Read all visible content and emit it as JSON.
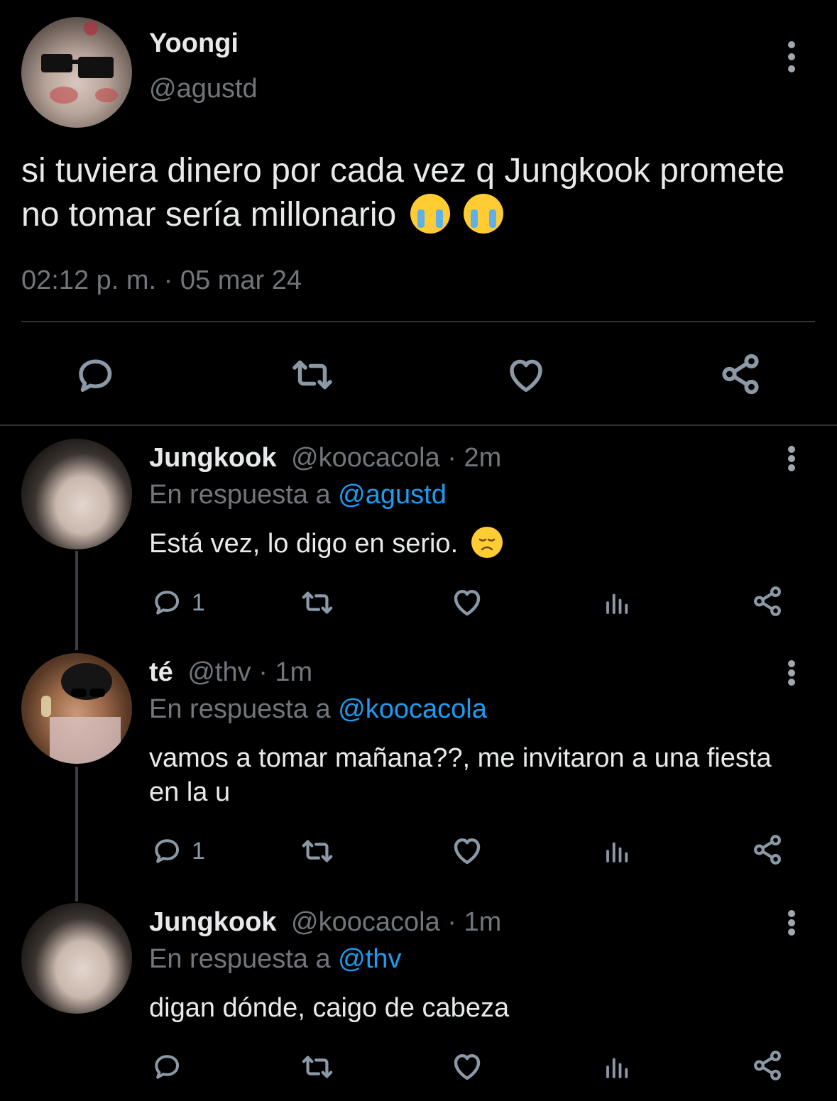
{
  "main_tweet": {
    "display_name": "Yoongi",
    "handle": "@agustd",
    "text": "si tuviera dinero por cada vez q Jungkook promete no tomar sería millonario",
    "emoji": "😭😭",
    "timestamp": "02:12 p. m. · 05 mar 24",
    "actions": [
      "reply-icon",
      "retweet-icon",
      "like-icon",
      "share-icon"
    ]
  },
  "replies": [
    {
      "display_name": "Jungkook",
      "handle": "@koocacola",
      "time": "· 2m",
      "reply_prefix": "En respuesta a",
      "reply_to": "@agustd",
      "text": "Está vez, lo digo en serio.",
      "emoji": "😞",
      "reply_count": "1"
    },
    {
      "display_name": "té",
      "handle": "@thv",
      "time": "· 1m",
      "reply_prefix": "En respuesta a",
      "reply_to": "@koocacola",
      "text": "vamos a tomar mañana??, me invitaron a una fiesta en la u",
      "reply_count": "1"
    },
    {
      "display_name": "Jungkook",
      "handle": "@koocacola",
      "time": "· 1m",
      "reply_prefix": "En respuesta a",
      "reply_to": "@thv",
      "text": "digan dónde, caigo de cabeza",
      "reply_count": ""
    }
  ],
  "colors": {
    "background": "#000000",
    "text": "#e7e9ea",
    "secondary": "#71767b",
    "mention": "#1d9bf0",
    "icon": "#8b98a5"
  }
}
